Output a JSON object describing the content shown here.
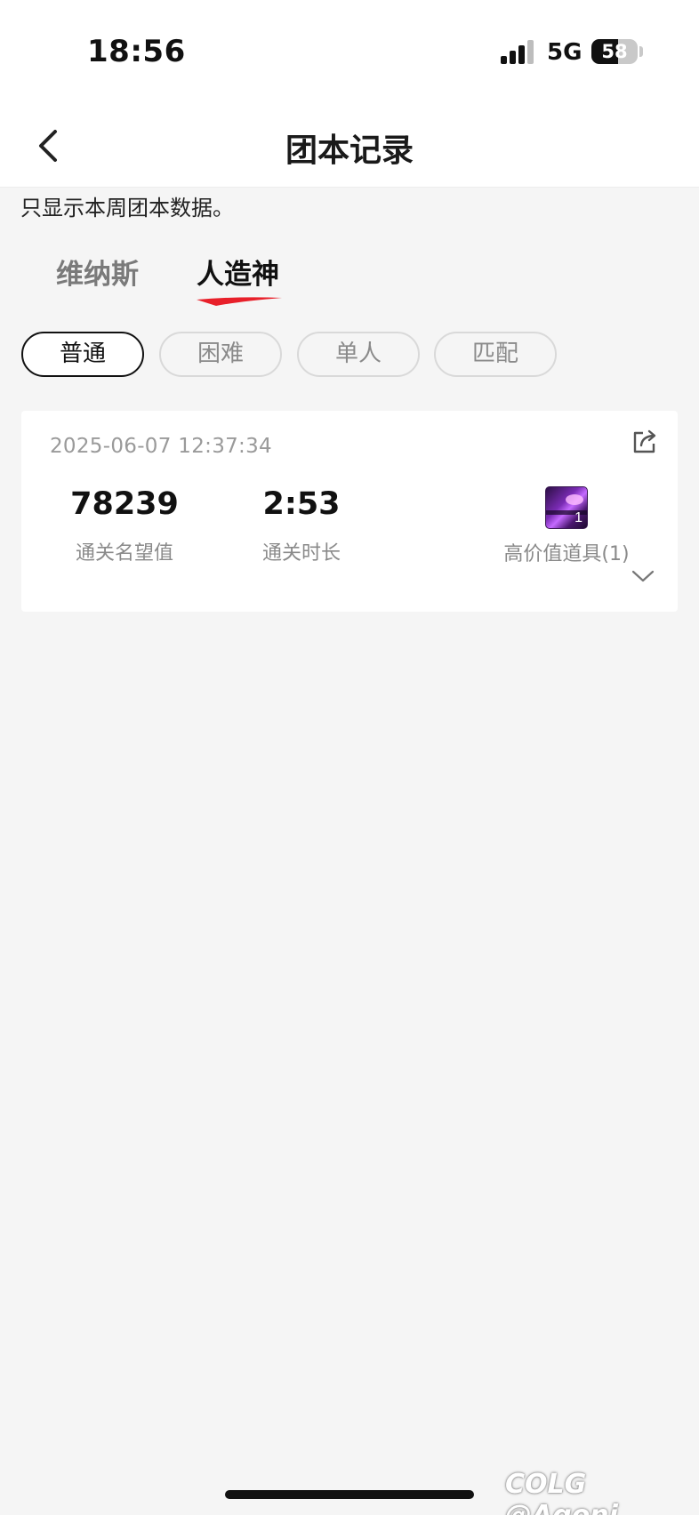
{
  "status_bar": {
    "time": "18:56",
    "network": "5G",
    "battery": "58"
  },
  "nav": {
    "title": "团本记录"
  },
  "notice": "只显示本周团本数据。",
  "tabs": [
    {
      "label": "维纳斯",
      "active": false
    },
    {
      "label": "人造神",
      "active": true
    }
  ],
  "filters": [
    {
      "label": "普通",
      "active": true
    },
    {
      "label": "困难",
      "active": false
    },
    {
      "label": "单人",
      "active": false
    },
    {
      "label": "匹配",
      "active": false
    }
  ],
  "record": {
    "timestamp": "2025-06-07 12:37:34",
    "fame_value": "78239",
    "fame_label": "通关名望值",
    "duration_value": "2:53",
    "duration_label": "通关时长",
    "item_count": "1",
    "item_label": "高价值道具(1)"
  },
  "watermark": "COLG @Agoni",
  "colors": {
    "accent": "#e8202a",
    "background": "#f5f5f5",
    "card": "#ffffff",
    "muted_text": "#8a8a8a"
  },
  "icons": {
    "back": "chevron-left-icon",
    "share": "share-icon",
    "expand": "chevron-down-icon"
  }
}
